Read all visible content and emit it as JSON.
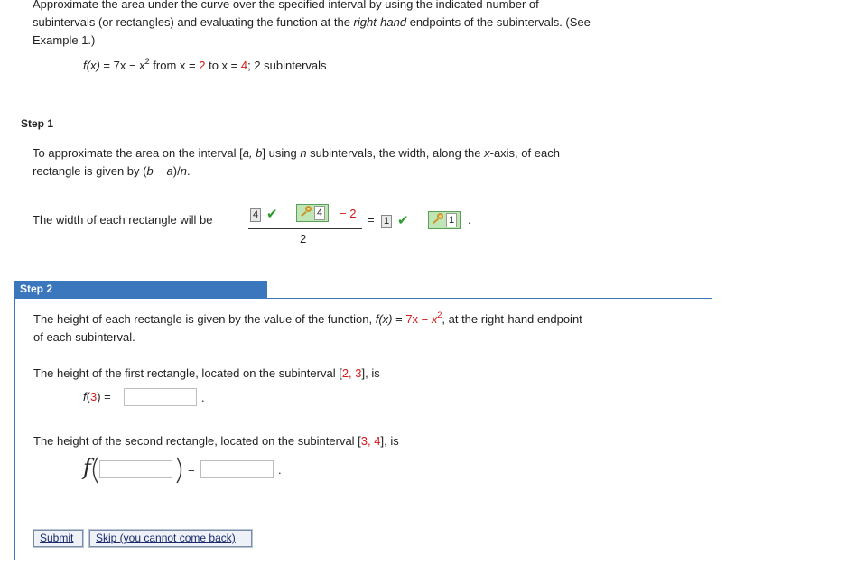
{
  "intro": {
    "line1": "Approximate the area under the curve over the specified interval by using the indicated number of",
    "line2_a": "subintervals (or rectangles) and evaluating the function at the ",
    "line2_italic": "right-hand",
    "line2_b": " endpoints of the subintervals. (See",
    "line3": "Example 1.)"
  },
  "problem": {
    "fx": "f(x)",
    "eq": " = ",
    "term1": "7x",
    "minus": " − ",
    "term2": "x",
    "exp": "2",
    "from_text": " from x = ",
    "a": "2",
    "to_text": " to x = ",
    "b": "4",
    "tail": "; 2 subintervals"
  },
  "step1": {
    "label": "Step 1",
    "text1_a": "To approximate the area on the interval [",
    "text1_ab": "a, b",
    "text1_b": "] using ",
    "text1_n": "n",
    "text1_c": " subintervals, the width, along the ",
    "text1_x": "x",
    "text1_d": "-axis, of each",
    "text2_a": "rectangle is given by (",
    "text2_b": "b",
    "text2_c": " − ",
    "text2_d": "a",
    "text2_e": ")/",
    "text2_f": "n",
    "text2_g": ".",
    "width_label": "The width of each rectangle will be",
    "num_given": "4",
    "num_key_value": "4",
    "minus_two": "− 2",
    "denominator": "2",
    "equals": "=",
    "result_given": "1",
    "result_key_value": "1",
    "period": "."
  },
  "step2": {
    "label": "Step 2",
    "text1_a": "The height of each rectangle is given by the value of the function, ",
    "fx": "f(x)",
    "eq": " = ",
    "term1": "7x",
    "minus": " − ",
    "term2": "x",
    "exp": "2",
    "text1_b": ",  at the right-hand endpoint",
    "text2": "of each subinterval.",
    "first_a": "The height of the first rectangle, located on the subinterval [",
    "first_int": "2, 3",
    "first_b": "], is",
    "f3_f": "f",
    "f3_open": "(",
    "f3_arg": "3",
    "f3_close": ") = ",
    "period1": ".",
    "second_a": "The height of the second rectangle, located on the subinterval [",
    "second_int": "3, 4",
    "second_b": "], is",
    "f_letter": "f",
    "eq2": "=",
    "period2": "."
  },
  "buttons": {
    "submit": "Submit",
    "skip": "Skip (you cannot come back)"
  },
  "colors": {
    "accent_blue": "#3a77bd",
    "red_value": "#d21a1a",
    "check_green": "#2e9b2e",
    "key_box_green": "#bfe6b4"
  }
}
